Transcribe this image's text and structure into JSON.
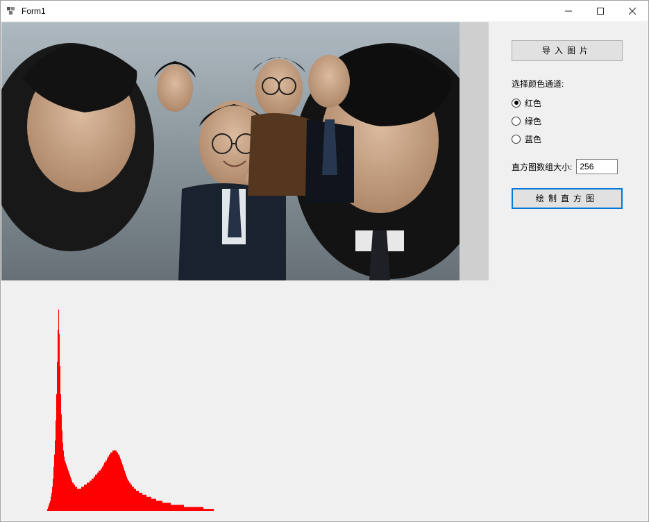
{
  "window": {
    "title": "Form1"
  },
  "controls": {
    "import_button": "导入图片",
    "channel_group_label": "选择颜色通道:",
    "channels": {
      "red": {
        "label": "红色",
        "checked": true
      },
      "green": {
        "label": "绿色",
        "checked": false
      },
      "blue": {
        "label": "蓝色",
        "checked": false
      }
    },
    "bins_label": "直方图数组大小:",
    "bins_value": "256",
    "draw_button": "绘制直方图"
  },
  "colors": {
    "histogram_fill": "#ff0000",
    "button_bg": "#e1e1e1",
    "button_border": "#adadad",
    "focus_border": "#0078d7",
    "panel_bg": "#f0f0f0",
    "image_letterbox": "#cfcfcf"
  },
  "chart_data": {
    "type": "bar",
    "title": "",
    "xlabel": "",
    "ylabel": "",
    "x_range": [
      0,
      255
    ],
    "y_range_relative": [
      0,
      1
    ],
    "categories_0_to_255_step_1": true,
    "values": [
      0.0,
      0.0,
      0.0,
      0.0,
      0.0,
      0.0,
      0.0,
      0.0,
      0.01,
      0.02,
      0.03,
      0.04,
      0.05,
      0.07,
      0.09,
      0.12,
      0.16,
      0.22,
      0.28,
      0.35,
      0.45,
      0.58,
      0.74,
      0.9,
      1.0,
      0.88,
      0.72,
      0.58,
      0.48,
      0.4,
      0.34,
      0.3,
      0.27,
      0.25,
      0.24,
      0.23,
      0.22,
      0.21,
      0.2,
      0.19,
      0.18,
      0.17,
      0.16,
      0.15,
      0.14,
      0.14,
      0.13,
      0.13,
      0.12,
      0.12,
      0.12,
      0.11,
      0.11,
      0.11,
      0.11,
      0.11,
      0.11,
      0.12,
      0.12,
      0.12,
      0.12,
      0.13,
      0.13,
      0.13,
      0.13,
      0.14,
      0.14,
      0.14,
      0.14,
      0.15,
      0.15,
      0.15,
      0.16,
      0.16,
      0.16,
      0.17,
      0.17,
      0.18,
      0.18,
      0.18,
      0.19,
      0.19,
      0.2,
      0.2,
      0.2,
      0.21,
      0.21,
      0.22,
      0.22,
      0.23,
      0.24,
      0.24,
      0.25,
      0.25,
      0.26,
      0.27,
      0.27,
      0.28,
      0.28,
      0.29,
      0.29,
      0.29,
      0.3,
      0.3,
      0.3,
      0.3,
      0.3,
      0.3,
      0.29,
      0.29,
      0.28,
      0.28,
      0.27,
      0.26,
      0.25,
      0.24,
      0.23,
      0.22,
      0.21,
      0.2,
      0.19,
      0.18,
      0.17,
      0.16,
      0.15,
      0.15,
      0.14,
      0.14,
      0.13,
      0.13,
      0.12,
      0.12,
      0.12,
      0.11,
      0.11,
      0.11,
      0.1,
      0.1,
      0.1,
      0.1,
      0.09,
      0.09,
      0.09,
      0.09,
      0.09,
      0.08,
      0.08,
      0.08,
      0.08,
      0.08,
      0.08,
      0.07,
      0.07,
      0.07,
      0.07,
      0.07,
      0.07,
      0.07,
      0.06,
      0.06,
      0.06,
      0.06,
      0.06,
      0.06,
      0.06,
      0.05,
      0.05,
      0.05,
      0.05,
      0.05,
      0.05,
      0.05,
      0.05,
      0.05,
      0.04,
      0.04,
      0.04,
      0.04,
      0.04,
      0.04,
      0.04,
      0.04,
      0.04,
      0.04,
      0.04,
      0.04,
      0.03,
      0.03,
      0.03,
      0.03,
      0.03,
      0.03,
      0.03,
      0.03,
      0.03,
      0.03,
      0.03,
      0.03,
      0.03,
      0.03,
      0.03,
      0.03,
      0.03,
      0.03,
      0.03,
      0.02,
      0.02,
      0.02,
      0.02,
      0.02,
      0.02,
      0.02,
      0.02,
      0.02,
      0.02,
      0.02,
      0.02,
      0.02,
      0.02,
      0.02,
      0.02,
      0.02,
      0.02,
      0.02,
      0.02,
      0.02,
      0.02,
      0.02,
      0.02,
      0.02,
      0.02,
      0.02,
      0.02,
      0.01,
      0.01,
      0.01,
      0.01,
      0.01,
      0.01,
      0.01,
      0.01,
      0.01,
      0.01,
      0.01,
      0.01,
      0.01,
      0.01,
      0.01,
      0.0,
      0.0,
      0.0,
      0.0,
      0.0,
      0.0,
      0.0,
      0.0
    ]
  }
}
